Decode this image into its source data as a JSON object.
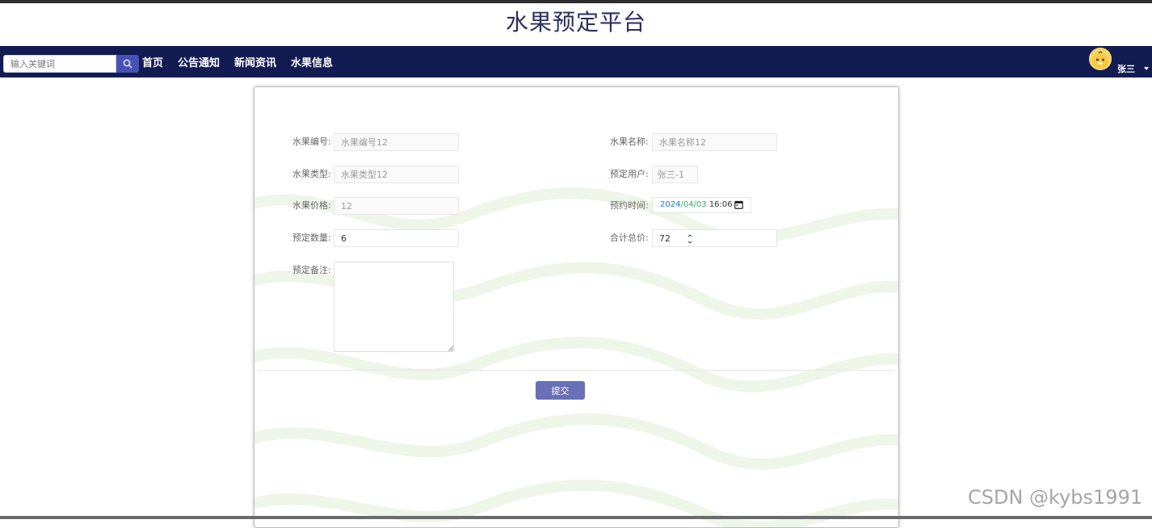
{
  "header": {
    "site_title": "水果预定平台"
  },
  "navbar": {
    "search_placeholder": "输入关键词",
    "links": [
      "首页",
      "公告通知",
      "新闻资讯",
      "水果信息"
    ],
    "user_name": "张三"
  },
  "form": {
    "fields": {
      "fruit_code": {
        "label": "水果编号:",
        "value": "水果编号12"
      },
      "fruit_name": {
        "label": "水果名称:",
        "value": "水果名称12"
      },
      "fruit_type": {
        "label": "水果类型:",
        "value": "水果类型12"
      },
      "order_user": {
        "label": "预定用户:",
        "value": "张三-1"
      },
      "fruit_price": {
        "label": "水果价格:",
        "value": "12"
      },
      "order_time": {
        "label": "预约时间:",
        "year": "2024",
        "month": "/04/03",
        "time": " 16:06"
      },
      "order_qty": {
        "label": "预定数量:",
        "value": "6"
      },
      "total_price": {
        "label": "合计总价:",
        "value": "72"
      },
      "remark": {
        "label": "预定备注:",
        "value": ""
      }
    },
    "submit_label": "提交"
  },
  "watermark": "CSDN @kybs1991",
  "colors": {
    "navbar": "#131c52",
    "search_button": "#4653b5",
    "submit_button": "#6a70b5",
    "title": "#2b2f5a"
  }
}
